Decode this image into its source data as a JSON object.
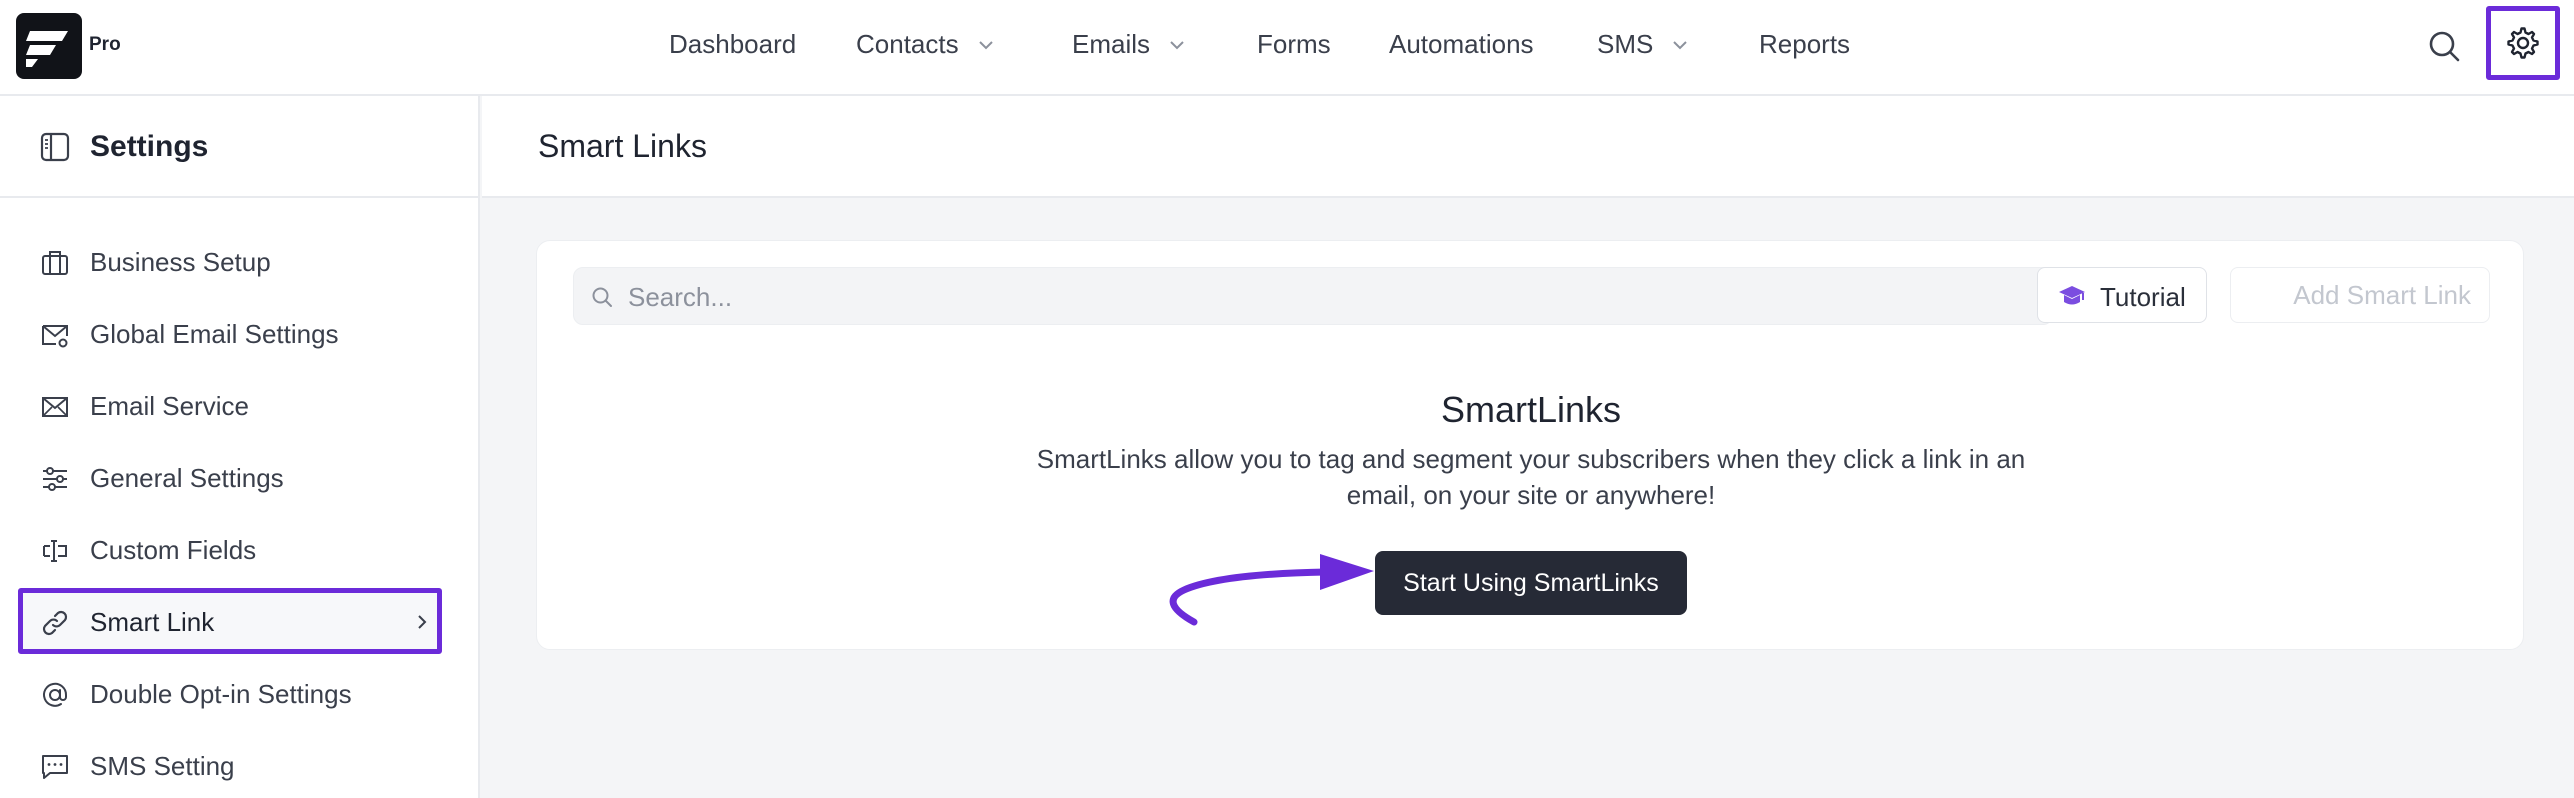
{
  "brand": {
    "badge": "Pro",
    "logo_icon": "fluentcrm-logo"
  },
  "nav": {
    "items": [
      {
        "label": "Dashboard",
        "has_dropdown": false
      },
      {
        "label": "Contacts",
        "has_dropdown": true
      },
      {
        "label": "Emails",
        "has_dropdown": true
      },
      {
        "label": "Forms",
        "has_dropdown": false
      },
      {
        "label": "Automations",
        "has_dropdown": false
      },
      {
        "label": "SMS",
        "has_dropdown": true
      },
      {
        "label": "Reports",
        "has_dropdown": false
      }
    ],
    "search_icon": "search-icon",
    "settings_icon": "gear-icon"
  },
  "sidebar": {
    "title": "Settings",
    "items": [
      {
        "label": "Business Setup",
        "icon": "briefcase-icon"
      },
      {
        "label": "Global Email Settings",
        "icon": "mail-settings-icon"
      },
      {
        "label": "Email Service",
        "icon": "send-mail-icon"
      },
      {
        "label": "General Settings",
        "icon": "sliders-icon"
      },
      {
        "label": "Custom Fields",
        "icon": "text-field-icon"
      },
      {
        "label": "Smart Link",
        "icon": "link-icon",
        "active": true
      },
      {
        "label": "Double Opt-in Settings",
        "icon": "at-sign-icon"
      },
      {
        "label": "SMS Setting",
        "icon": "message-icon"
      }
    ]
  },
  "main": {
    "title": "Smart Links",
    "search": {
      "placeholder": "Search...",
      "value": ""
    },
    "tutorial_label": "Tutorial",
    "add_label": "Add Smart Link",
    "empty": {
      "title": "SmartLinks",
      "description": "SmartLinks allow you to tag and segment your subscribers when they click a link in an email, on your site or anywhere!",
      "cta_label": "Start Using SmartLinks"
    }
  },
  "colors": {
    "highlight": "#6b2bd9",
    "cta_bg": "#262a36",
    "tutorial_icon": "#7b4de0"
  }
}
